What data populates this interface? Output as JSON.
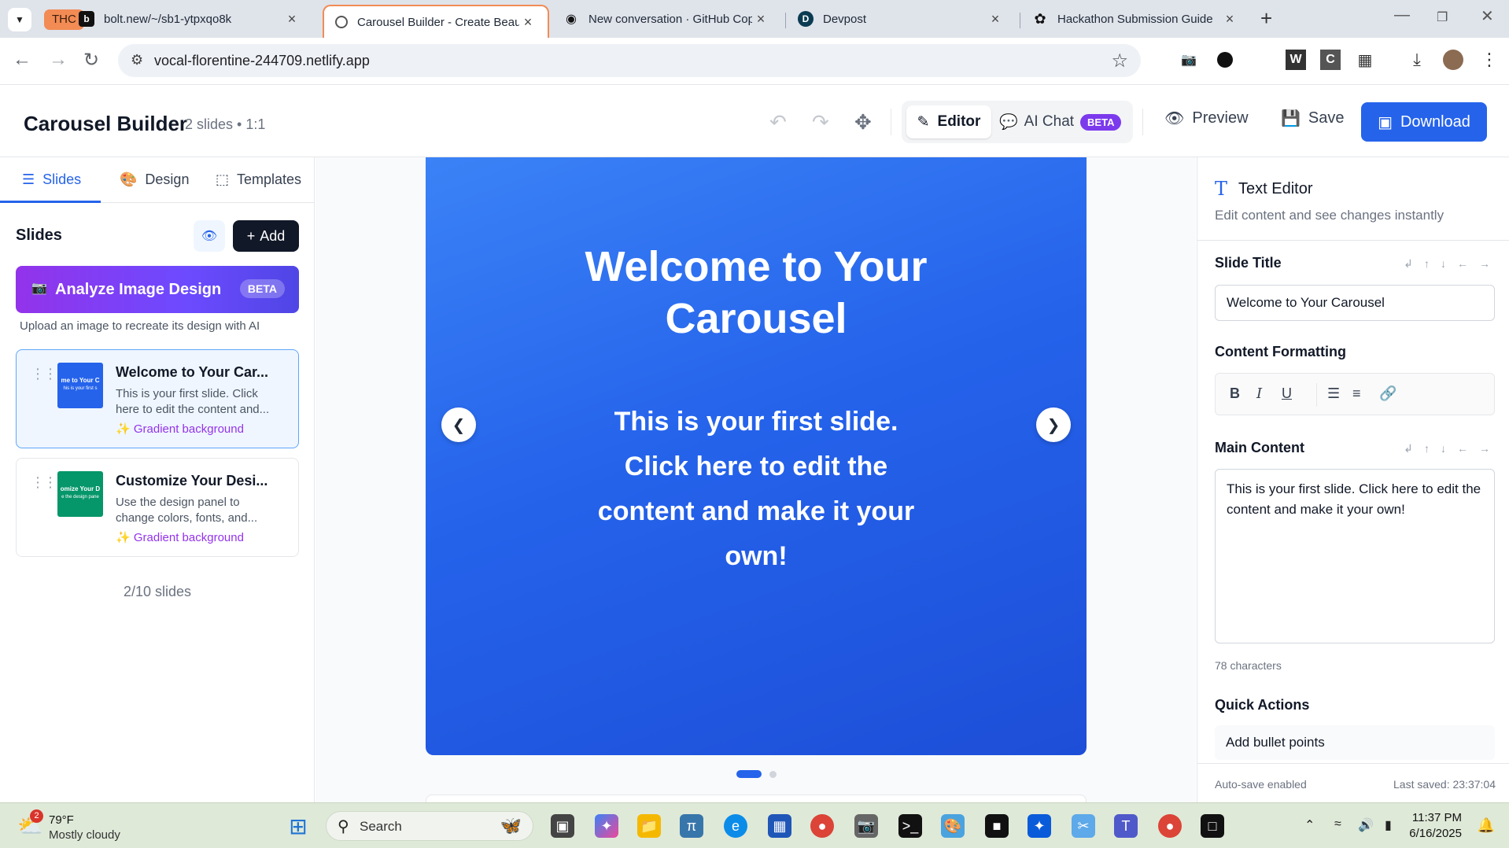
{
  "browser": {
    "tab_group": "THC",
    "tabs": [
      {
        "title": "bolt.new/~/sb1-ytpxqo8k",
        "favicon": "b"
      },
      {
        "title": "Carousel Builder - Create Beaut",
        "favicon": "globe"
      },
      {
        "title": "New conversation · GitHub Cop",
        "favicon": "copilot"
      },
      {
        "title": "Devpost",
        "favicon": "D"
      },
      {
        "title": "Hackathon Submission Guide",
        "favicon": "openai"
      }
    ],
    "url": "vocal-florentine-244709.netlify.app"
  },
  "header": {
    "title": "Carousel Builder",
    "subtitle": "2 slides • 1:1",
    "editor_label": "Editor",
    "ai_chat_label": "AI Chat",
    "beta": "BETA",
    "preview_label": "Preview",
    "save_label": "Save",
    "download_label": "Download"
  },
  "sidebar": {
    "tabs": [
      "Slides",
      "Design",
      "Templates"
    ],
    "heading": "Slides",
    "add_label": "Add",
    "analyze_label": "Analyze Image Design",
    "analyze_badge": "BETA",
    "analyze_hint": "Upload an image to recreate its design with AI",
    "slides": [
      {
        "title": "Welcome to Your Car...",
        "desc": "This is your first slide. Click here to edit the content and...",
        "tag": "Gradient background",
        "thumb_title": "me to Your C",
        "thumb_body": "his is your first s",
        "color": "#2563eb"
      },
      {
        "title": "Customize Your Desi...",
        "desc": "Use the design panel to change colors, fonts, and...",
        "tag": "Gradient background",
        "thumb_title": "omize Your D",
        "thumb_body": "e the design pane",
        "color": "#059669"
      }
    ],
    "slide_count": "2/10 slides"
  },
  "canvas": {
    "slide_title": "Welcome to Your Carousel",
    "slide_body": "This is your first slide. Click here to edit the content and make it your own!",
    "current_slide": 1,
    "total_slides": 2
  },
  "text_editor": {
    "title": "Text Editor",
    "subtitle": "Edit content and see changes instantly",
    "slide_title_label": "Slide Title",
    "slide_title_value": "Welcome to Your Carousel",
    "formatting_label": "Content Formatting",
    "main_content_label": "Main Content",
    "main_content_value": "This is your first slide. Click here to edit the content and make it your own!",
    "char_count": "78 characters",
    "quick_actions_label": "Quick Actions",
    "quick_action_1": "Add bullet points",
    "autosave": "Auto-save enabled",
    "last_saved": "Last saved: 23:37:04"
  },
  "taskbar": {
    "weather_badge": "2",
    "temperature": "79°F",
    "condition": "Mostly cloudy",
    "search_label": "Search",
    "time": "11:37 PM",
    "date": "6/16/2025"
  }
}
